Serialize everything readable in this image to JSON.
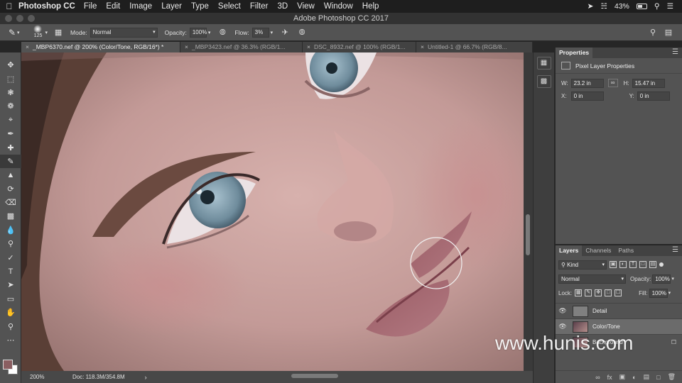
{
  "menubar": {
    "app_name": "Photoshop CC",
    "items": [
      "File",
      "Edit",
      "Image",
      "Layer",
      "Type",
      "Select",
      "Filter",
      "3D",
      "View",
      "Window",
      "Help"
    ],
    "battery": "43%"
  },
  "window": {
    "title": "Adobe Photoshop CC 2017"
  },
  "options_bar": {
    "brush_size": "125",
    "mode_label": "Mode:",
    "mode_value": "Normal",
    "opacity_label": "Opacity:",
    "opacity_value": "100%",
    "flow_label": "Flow:",
    "flow_value": "3%"
  },
  "doc_tabs": [
    {
      "label": "_MBP6370.nef @ 200% (Color/Tone, RGB/16*) *",
      "active": true
    },
    {
      "label": "_MBP3423.nef @ 36.3% (RGB/1...",
      "active": false
    },
    {
      "label": "DSC_8932.nef @ 100% (RGB/1...",
      "active": false
    },
    {
      "label": "Untitled-1 @ 66.7% (RGB/8...",
      "active": false
    }
  ],
  "status_bar": {
    "zoom": "200%",
    "doc_info": "Doc: 118.3M/354.8M"
  },
  "properties_panel": {
    "tab": "Properties",
    "heading": "Pixel Layer Properties",
    "w_label": "W:",
    "w_value": "23.2 in",
    "h_label": "H:",
    "h_value": "15.47 in",
    "x_label": "X:",
    "x_value": "0 in",
    "y_label": "Y:",
    "y_value": "0 in"
  },
  "layers_panel": {
    "tabs": [
      "Layers",
      "Channels",
      "Paths"
    ],
    "filter_kind": "Kind",
    "blend_mode": "Normal",
    "opacity_label": "Opacity:",
    "opacity_value": "100%",
    "lock_label": "Lock:",
    "fill_label": "Fill:",
    "fill_value": "100%",
    "layers": [
      {
        "name": "Detail",
        "selected": false
      },
      {
        "name": "Color/Tone",
        "selected": true
      },
      {
        "name": "Background",
        "selected": false
      }
    ]
  },
  "watermark": "www.hunis.com",
  "colors": {
    "foreground": "#8a5e61",
    "background": "#ffffff"
  }
}
